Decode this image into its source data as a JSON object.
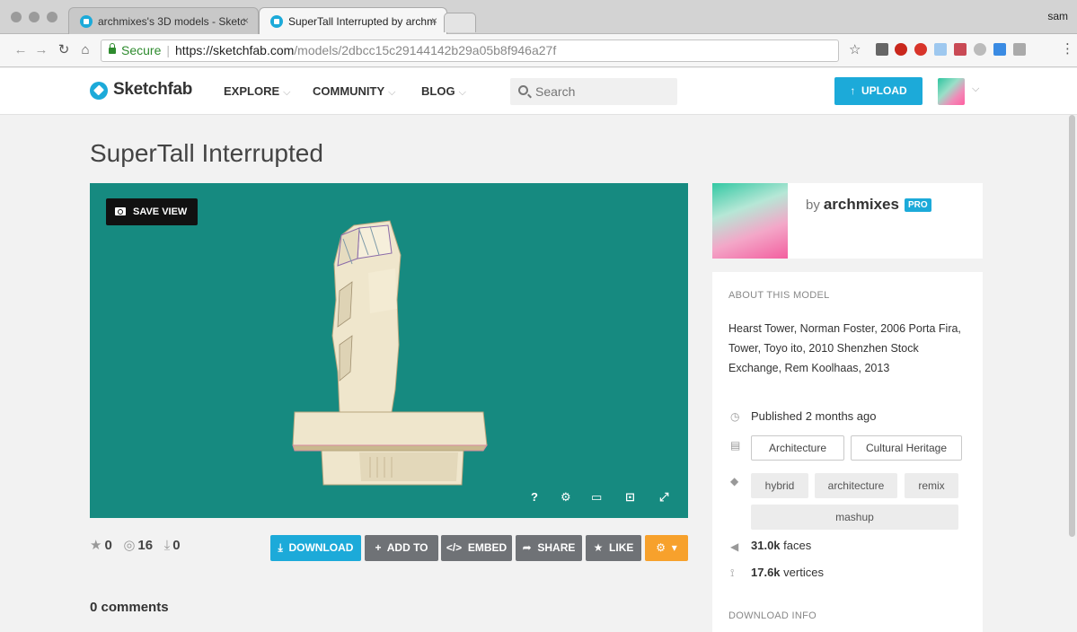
{
  "browser": {
    "tabs": [
      {
        "label": "archmixes's 3D models - Sketc",
        "close": "×"
      },
      {
        "label": "SuperTall Interrupted by archm",
        "close": "×"
      }
    ],
    "user": "sam",
    "secure_label": "Secure",
    "url_host": "https://sketchfab.com",
    "url_path": "/models/2dbcc15c29144142b29a05b8f946a27f"
  },
  "header": {
    "brand": "Sketchfab",
    "nav": [
      {
        "label": "EXPLORE"
      },
      {
        "label": "COMMUNITY"
      },
      {
        "label": "BLOG"
      }
    ],
    "search_placeholder": "Search",
    "upload_label": "UPLOAD"
  },
  "model": {
    "title": "SuperTall Interrupted",
    "save_view_label": "SAVE VIEW",
    "stats": {
      "likes": "0",
      "views": "16",
      "downloads": "0"
    },
    "actions": {
      "download": "DOWNLOAD",
      "add_to": "ADD TO",
      "embed": "EMBED",
      "share": "SHARE",
      "like": "LIKE"
    },
    "comments": "0 comments"
  },
  "author": {
    "by": "by",
    "name": "archmixes",
    "badge": "PRO"
  },
  "about": {
    "heading": "ABOUT THIS MODEL",
    "description": "Hearst Tower, Norman Foster, 2006 Porta Fira, Tower, Toyo ito, 2010 Shenzhen Stock Exchange, Rem Koolhaas, 2013",
    "published": "Published 2 months ago",
    "categories": [
      "Architecture",
      "Cultural Heritage"
    ],
    "tags": [
      "hybrid",
      "architecture",
      "remix",
      "mashup"
    ],
    "faces_value": "31.0k",
    "faces_label": "faces",
    "vertices_value": "17.6k",
    "vertices_label": "vertices",
    "download_info": "DOWNLOAD INFO"
  },
  "colors": {
    "accent": "#1caad9",
    "viewer_bg": "#168a80",
    "action_grey": "#6f7276",
    "action_orange": "#f7a12c"
  },
  "icons": [
    "search-icon",
    "camera-icon",
    "help-icon",
    "settings-icon",
    "vr-icon",
    "embed-icon",
    "fullscreen-icon",
    "star-icon",
    "eye-icon",
    "download-icon",
    "clock-icon",
    "folder-icon",
    "tag-icon",
    "triangle-icon",
    "vertex-icon"
  ]
}
